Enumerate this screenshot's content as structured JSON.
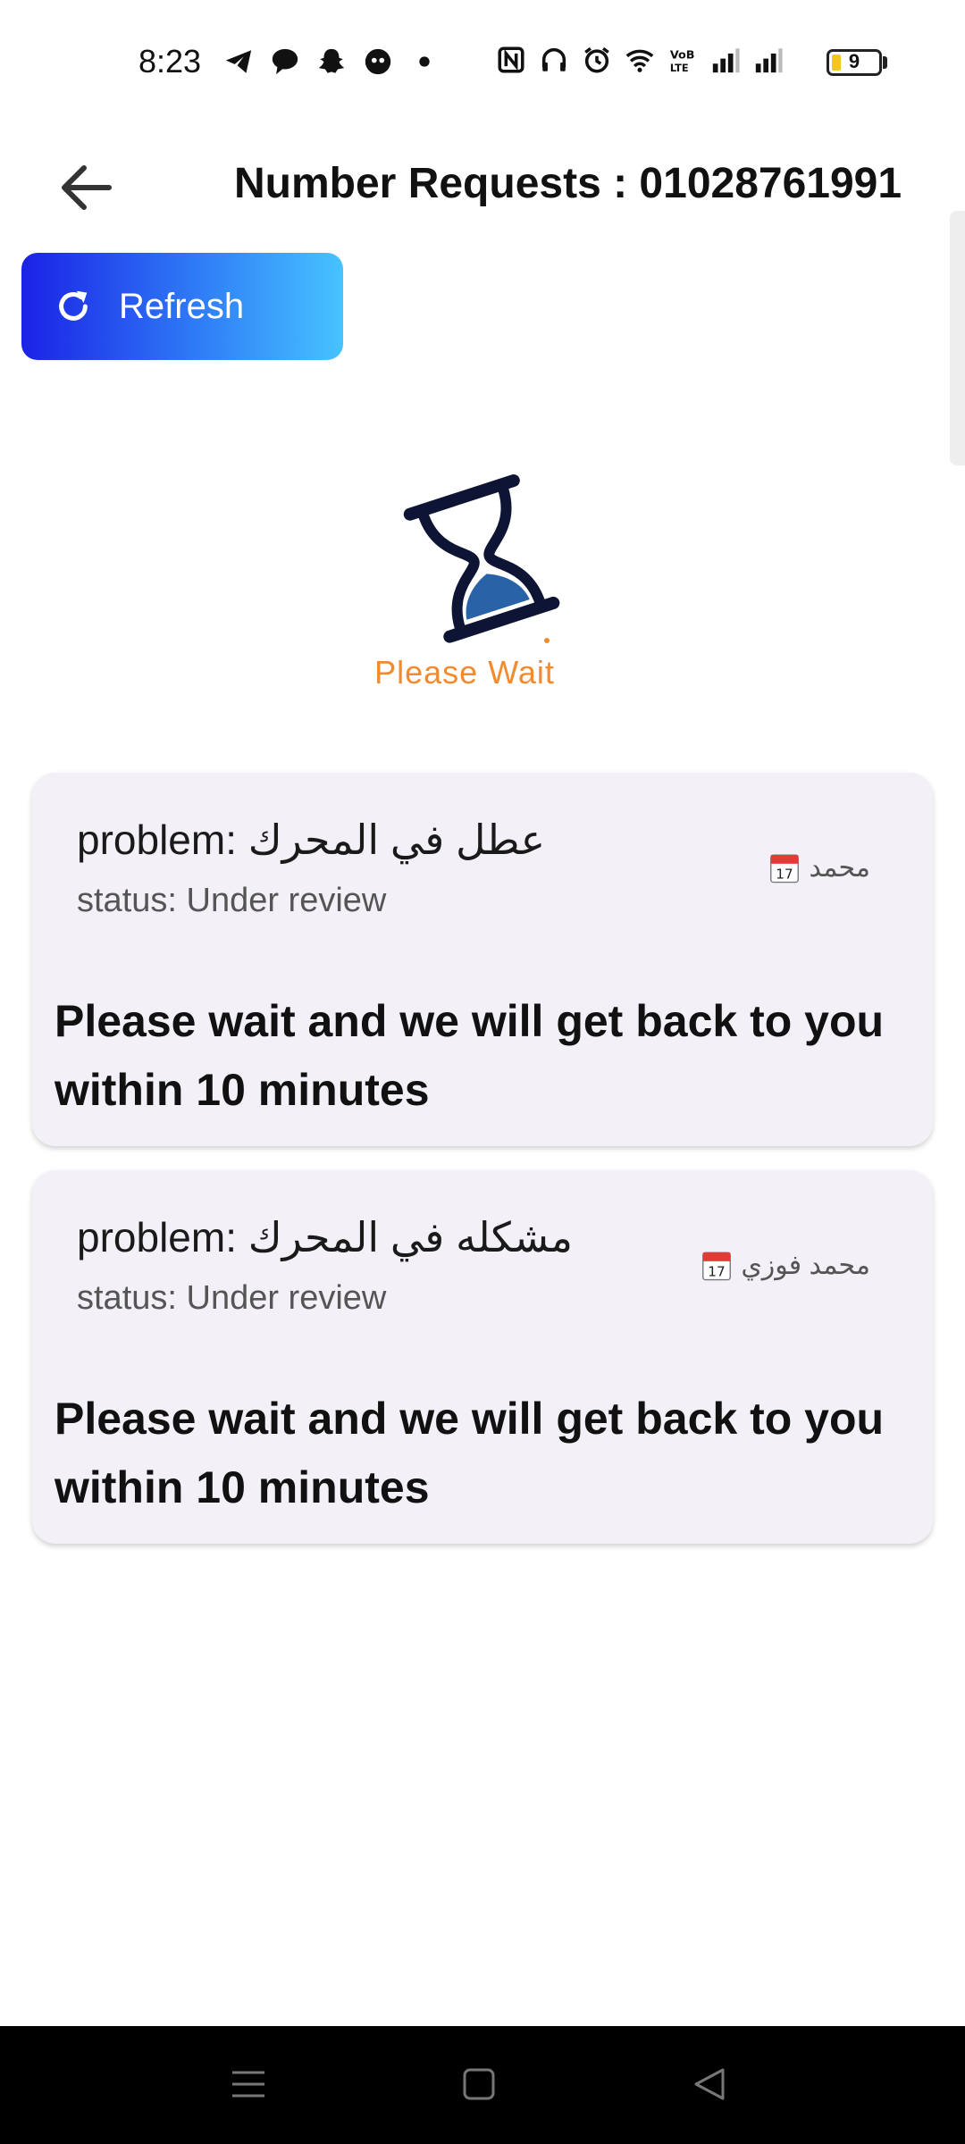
{
  "status_bar": {
    "time": "8:23",
    "battery_level": "9",
    "left_icons": [
      "telegram-icon",
      "chat-bubble-icon",
      "snapchat-icon",
      "app-icon",
      "dot-icon"
    ],
    "right_icons": [
      "nfc-icon",
      "headphones-icon",
      "alarm-icon",
      "wifi-icon",
      "volte-icon",
      "signal-icon",
      "signal-icon"
    ]
  },
  "app_bar": {
    "title": "Number Requests : 01028761991",
    "back_icon": "arrow-left-icon"
  },
  "refresh_button": {
    "label": "Refresh",
    "icon": "refresh-icon",
    "gradient": [
      "#1b22e6",
      "#47c3ff"
    ]
  },
  "loader": {
    "label": "Please Wait",
    "label_color": "#f28a2e",
    "icon": "hourglass-icon"
  },
  "requests": [
    {
      "problem": "problem: عطل في المحرك",
      "status": "status: Under review",
      "name": "محمد",
      "message": "Please wait and we will get back to you within 10 minutes"
    },
    {
      "problem": "problem: مشكله في المحرك",
      "status": "status: Under review",
      "name": "محمد فوزي",
      "message": "Please wait and we will get back to you within 10 minutes"
    }
  ],
  "nav_bar": {
    "buttons": [
      "menu-icon",
      "home-icon",
      "back-triangle-icon"
    ]
  },
  "colors": {
    "card_bg": "#f4f0f8",
    "accent_orange": "#f28a2e"
  }
}
